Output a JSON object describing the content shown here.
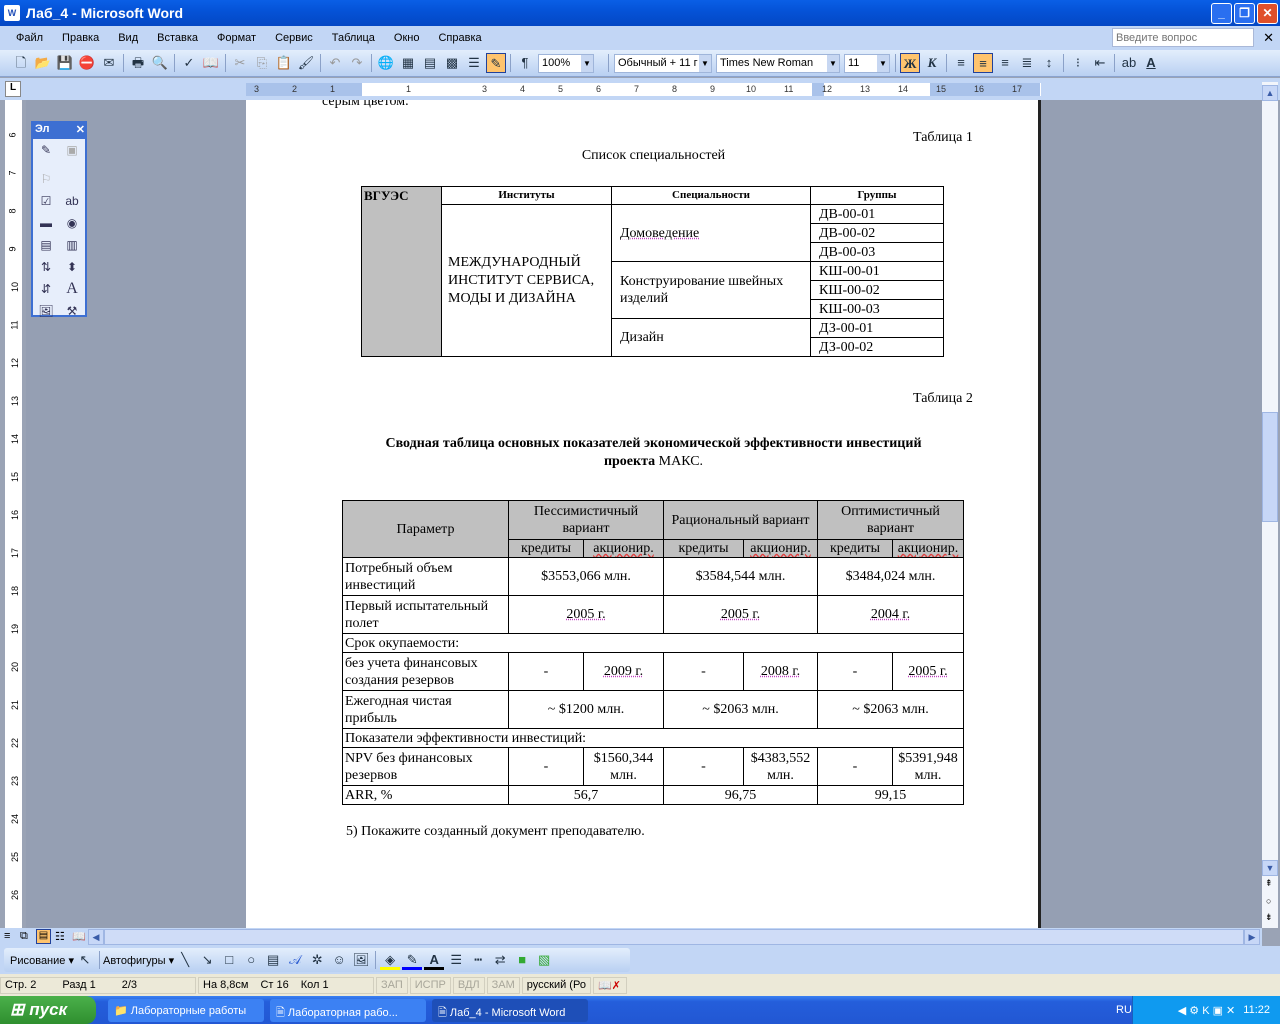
{
  "window": {
    "title": "Лаб_4 - Microsoft Word"
  },
  "menu": [
    "Файл",
    "Правка",
    "Вид",
    "Вставка",
    "Формат",
    "Сервис",
    "Таблица",
    "Окно",
    "Справка"
  ],
  "help": {
    "placeholder": "Введите вопрос"
  },
  "toolbar": {
    "zoom": "100%",
    "style": "Обычный + 11 г",
    "font": "Times New Roman",
    "size": "11",
    "bold": "Ж",
    "italic": "К",
    "pilcrow": "¶"
  },
  "ruler": {
    "h_ticks": [
      "3",
      "2",
      "1",
      "1",
      "3",
      "4",
      "5",
      "6",
      "7",
      "8",
      "9",
      "10",
      "11",
      "12",
      "13",
      "14",
      "15",
      "16",
      "17"
    ],
    "v_ticks": [
      "6",
      "7",
      "8",
      "9",
      "10",
      "11",
      "12",
      "13",
      "14",
      "15",
      "16",
      "17",
      "18",
      "19",
      "20",
      "21",
      "22",
      "23",
      "24",
      "25",
      "26"
    ]
  },
  "floating_toolbar": {
    "title": "Эл"
  },
  "document": {
    "prev_text": "серым цветом.",
    "table1_label": "Таблица 1",
    "table1_title": "Список специальностей",
    "table1": {
      "corner": "ВГУЭС",
      "headers": [
        "Институты",
        "Специальности",
        "Группы"
      ],
      "institute": "МЕЖДУНАРОДНЫЙ ИНСТИТУТ СЕРВИСА, МОДЫ И ДИЗАЙНА",
      "specialties": [
        {
          "name": "Домоведение",
          "groups": [
            "ДВ-00-01",
            "ДВ-00-02",
            "ДВ-00-03"
          ]
        },
        {
          "name": "Конструирование швейных изделий",
          "groups": [
            "КШ-00-01",
            "КШ-00-02",
            "КШ-00-03"
          ]
        },
        {
          "name": "Дизайн",
          "groups": [
            "ДЗ-00-01",
            "ДЗ-00-02"
          ]
        }
      ]
    },
    "table2_label": "Таблица 2",
    "table2_title_bold": "Сводная таблица основных показателей экономической эффективности инвестиций",
    "table2_title_line2_bold": "проекта",
    "table2_title_line2": " МАКС.",
    "table2": {
      "param": "Параметр",
      "variants": [
        "Пессимистичный вариант",
        "Рациональный вариант",
        "Оптимистичный вариант"
      ],
      "sub": [
        "кредиты",
        "акционир."
      ],
      "r_need": {
        "label": "Потребный объем инвестиций",
        "v": [
          "$3553,066 млн.",
          "$3584,544 млн.",
          "$3484,024 млн."
        ]
      },
      "r_flight": {
        "label": "Первый испытательный полет",
        "v": [
          "2005 г.",
          "2005 г.",
          "2004 г."
        ]
      },
      "payback": "Срок окупаемости:",
      "r_pay": {
        "label": "без учета финансовых создания резервов",
        "v": [
          "-",
          "2009 г.",
          "-",
          "2008 г.",
          "-",
          "2005 г."
        ]
      },
      "r_profit": {
        "label": "Ежегодная чистая прибыль",
        "v": [
          "~ $1200 млн.",
          "~ $2063 млн.",
          "~ $2063 млн."
        ]
      },
      "efficiency": "Показатели эффективности инвестиций:",
      "r_npv": {
        "label": "NPV без финансовых резервов",
        "v": [
          "-",
          "$1560,344 млн.",
          "-",
          "$4383,552 млн.",
          "-",
          "$5391,948 млн."
        ]
      },
      "r_arr": {
        "label": "ARR, %",
        "v": [
          "56,7",
          "96,75",
          "99,15"
        ]
      }
    },
    "step5": "5) Покажите созданный документ преподавателю."
  },
  "drawing": {
    "draw": "Рисование ▾",
    "autoshapes": "Автофигуры ▾"
  },
  "status": {
    "page": "Стр. 2",
    "section": "Разд 1",
    "pages": "2/3",
    "at": "На 8,8см",
    "line": "Ст 16",
    "col": "Кол 1",
    "rec": "ЗАП",
    "trk": "ИСПР",
    "ext": "ВДЛ",
    "ovr": "ЗАМ",
    "lang": "русский (Ро"
  },
  "taskbar": {
    "start": "пуск",
    "tasks": [
      "Лабораторные работы",
      "Лабораторная рабо...",
      "Лаб_4 - Microsoft Word"
    ],
    "lang": "RU",
    "clock": "11:22"
  },
  "colors": {
    "titlebar": "#0553d8",
    "menubar": "#c2d6f5",
    "active_button": "#ffc46e",
    "table_shade": "#c0c0c0",
    "taskbar": "#245edb",
    "start": "#2f8f2f"
  }
}
